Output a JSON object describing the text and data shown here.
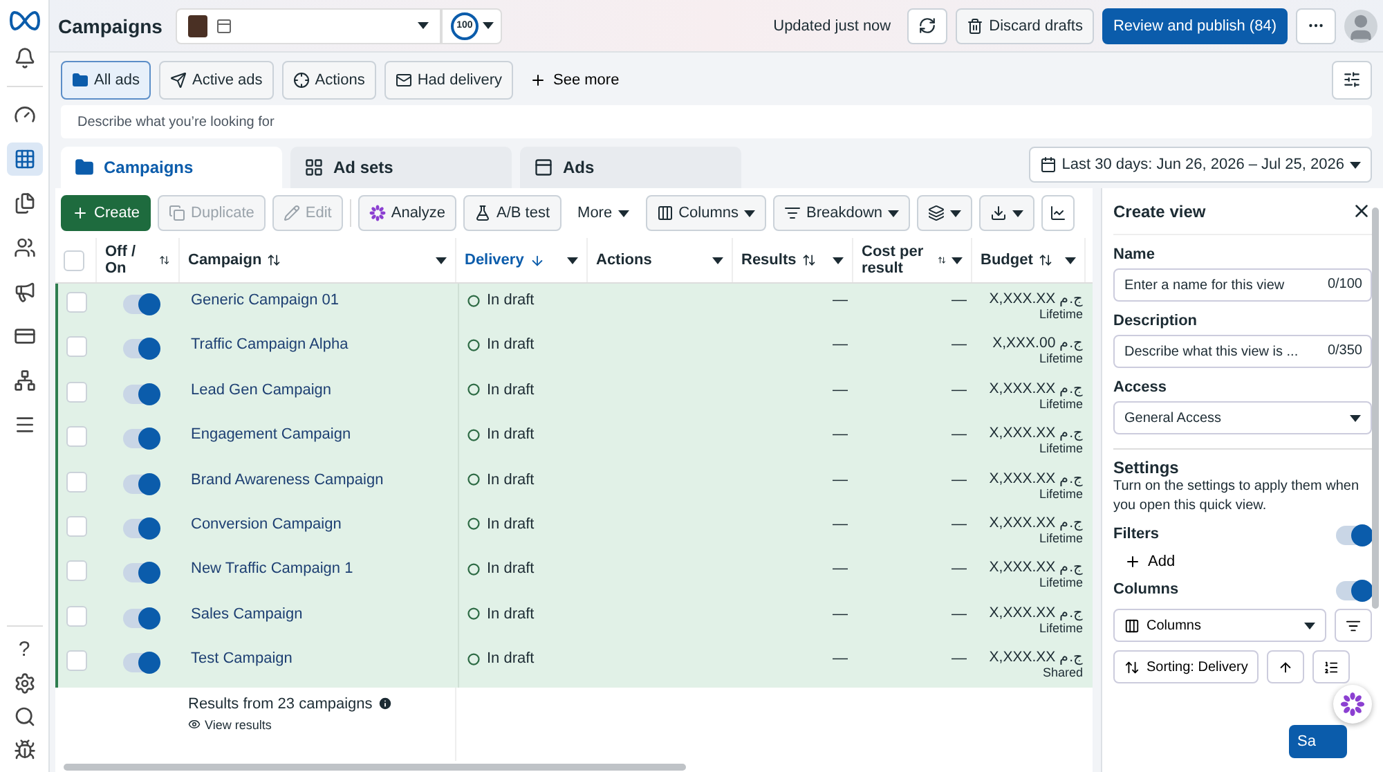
{
  "header": {
    "title": "Campaigns",
    "score": "100",
    "status": "Updated just now",
    "discard": "Discard drafts",
    "publish": "Review and publish (84)"
  },
  "sidebar": {
    "items": [
      {
        "kind": "bell",
        "selected": false
      },
      {
        "kind": "gauge",
        "selected": false
      },
      {
        "kind": "grid",
        "selected": true
      },
      {
        "kind": "pages",
        "selected": false
      },
      {
        "kind": "people",
        "selected": false
      },
      {
        "kind": "megaphone",
        "selected": false
      },
      {
        "kind": "card",
        "selected": false
      },
      {
        "kind": "network",
        "selected": false
      },
      {
        "kind": "menu",
        "selected": false
      }
    ],
    "bottom": [
      "?"
    ]
  },
  "filters": [
    {
      "kind": "folder",
      "label": "All ads",
      "selected": true
    },
    {
      "kind": "send",
      "label": "Active ads",
      "selected": false
    },
    {
      "kind": "target",
      "label": "Actions",
      "selected": false
    },
    {
      "kind": "mail",
      "label": "Had delivery",
      "selected": false
    }
  ],
  "see_more": "See more",
  "search": {
    "placeholder": "Describe what you’re looking for"
  },
  "level_tabs": [
    {
      "kind": "campaigns",
      "label": "Campaigns",
      "selected": true
    },
    {
      "kind": "adsets",
      "label": "Ad sets",
      "selected": false
    },
    {
      "kind": "ads",
      "label": "Ads",
      "selected": false
    }
  ],
  "date_range": "Last 30 days: Jun 26, 2026 – Jul 25, 2026",
  "toolbar": [
    {
      "kind": "create",
      "label": "Create",
      "disabled": false
    },
    {
      "kind": "duplicate",
      "label": "Duplicate",
      "disabled": true
    },
    {
      "kind": "edit",
      "label": "Edit",
      "disabled": true
    },
    {
      "kind": "analyze",
      "label": "Analyze",
      "disabled": false
    },
    {
      "kind": "abtest",
      "label": "A/B test",
      "disabled": false
    },
    {
      "kind": "more",
      "label": "More",
      "disabled": false
    },
    {
      "kind": "columns",
      "label": "Columns",
      "disabled": false
    },
    {
      "kind": "breakdown",
      "label": "Breakdown",
      "disabled": false
    }
  ],
  "table": {
    "select_all_checked": false,
    "columns": [
      {
        "label": "Off / On",
        "sortable": true,
        "sorted": false,
        "menu": false,
        "selected": false
      },
      {
        "label": "Campaign",
        "sortable": true,
        "sorted": false,
        "menu": true,
        "selected": false
      },
      {
        "label": "Delivery",
        "sortable": true,
        "sorted": true,
        "menu": true,
        "selected": true
      },
      {
        "label": "Actions",
        "sortable": false,
        "menu": true,
        "selected": false
      },
      {
        "label": "Results",
        "sortable": true,
        "sorted": false,
        "menu": true,
        "selected": false
      },
      {
        "label": "Cost per result",
        "sortable": true,
        "sorted": false,
        "menu": true,
        "selected": false
      },
      {
        "label": "Budget",
        "sortable": true,
        "sorted": false,
        "menu": true,
        "selected": false
      }
    ],
    "rows": [
      {
        "checked": false,
        "on": true,
        "name": "Generic Campaign 01",
        "delivery": "In draft",
        "results": "—",
        "cost": "—",
        "budget": "X,XXX.XX ج.م",
        "budget_type": "Lifetime"
      },
      {
        "checked": false,
        "on": true,
        "name": "Traffic Campaign Alpha",
        "delivery": "In draft",
        "results": "—",
        "cost": "—",
        "budget": "X,XXX.00 ج.م",
        "budget_type": "Lifetime"
      },
      {
        "checked": false,
        "on": true,
        "name": "Lead Gen Campaign",
        "delivery": "In draft",
        "results": "—",
        "cost": "—",
        "budget": "X,XXX.XX ج.م",
        "budget_type": "Lifetime"
      },
      {
        "checked": false,
        "on": true,
        "name": "Engagement Campaign",
        "delivery": "In draft",
        "results": "—",
        "cost": "—",
        "budget": "X,XXX.XX ج.م",
        "budget_type": "Lifetime"
      },
      {
        "checked": false,
        "on": true,
        "name": "Brand Awareness Campaign",
        "delivery": "In draft",
        "results": "—",
        "cost": "—",
        "budget": "X,XXX.XX ج.م",
        "budget_type": "Lifetime"
      },
      {
        "checked": false,
        "on": true,
        "name": "Conversion Campaign",
        "delivery": "In draft",
        "results": "—",
        "cost": "—",
        "budget": "X,XXX.XX ج.م",
        "budget_type": "Lifetime"
      },
      {
        "checked": false,
        "on": true,
        "name": "New Traffic Campaign 1",
        "delivery": "In draft",
        "results": "—",
        "cost": "—",
        "budget": "X,XXX.XX ج.م",
        "budget_type": "Lifetime"
      },
      {
        "checked": false,
        "on": true,
        "name": "Sales Campaign",
        "delivery": "In draft",
        "results": "—",
        "cost": "—",
        "budget": "X,XXX.XX ج.م",
        "budget_type": "Lifetime"
      },
      {
        "checked": false,
        "on": true,
        "name": "Test Campaign",
        "delivery": "In draft",
        "results": "—",
        "cost": "—",
        "budget": "X,XXX.XX ج.م",
        "budget_type": "Shared"
      }
    ],
    "footer": {
      "summary": "Results from 23 campaigns",
      "link": "View results"
    }
  },
  "panel": {
    "title": "Create view",
    "name": {
      "label": "Name",
      "placeholder": "Enter a name for this view",
      "counter": "0/100"
    },
    "description": {
      "label": "Description",
      "placeholder": "Describe what this view is ...",
      "counter": "0/350"
    },
    "access": {
      "label": "Access",
      "value": "General Access"
    },
    "settings": {
      "title": "Settings",
      "text": "Turn on the settings to apply them when you open this quick view."
    },
    "filters": {
      "label": "Filters",
      "on": true,
      "add": "Add"
    },
    "columns": {
      "label": "Columns",
      "on": true,
      "select": "Columns",
      "sorting": "Sorting: Delivery"
    },
    "save": "Sa"
  }
}
